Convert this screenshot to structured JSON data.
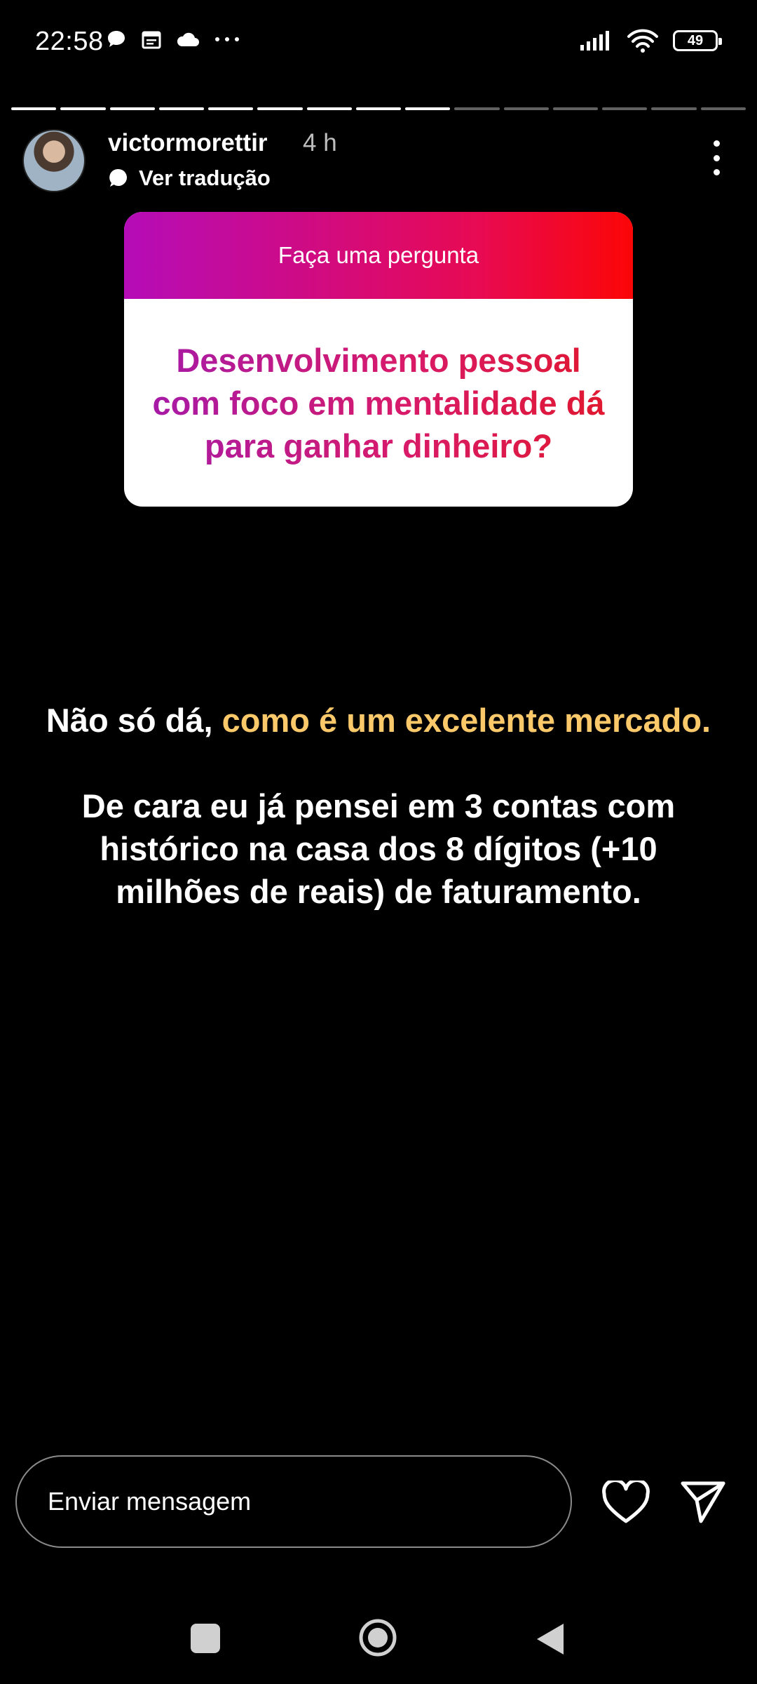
{
  "status_bar": {
    "time": "22:58",
    "battery": "49",
    "icons_left": [
      "chat-bubble-icon",
      "calendar-icon",
      "cloud-icon",
      "more-horizontal-icon"
    ],
    "icons_right": [
      "signal-icon",
      "wifi-icon",
      "battery-icon"
    ]
  },
  "progress": {
    "total_segments": 15,
    "completed_segments": 9
  },
  "story": {
    "username": "victormorettir",
    "time_ago": "4 h",
    "translate_label": "Ver tradução"
  },
  "sticker": {
    "header": "Faça uma pergunta",
    "question": "Desenvolvimento pessoal com foco em mentalidade dá para ganhar dinheiro?",
    "colors": {
      "gradient_start": "#b50cb8",
      "gradient_end": "#fb0606"
    }
  },
  "answer": {
    "part1_plain": "Não só dá, ",
    "part1_highlight": "como é um excelente mercado.",
    "part2": "De cara eu já pensei em 3 contas com histórico na casa dos 8 dígitos (+10 milhões de reais) de faturamento.",
    "highlight_color": "#fbc96a"
  },
  "footer": {
    "message_placeholder": "Enviar mensagem"
  }
}
